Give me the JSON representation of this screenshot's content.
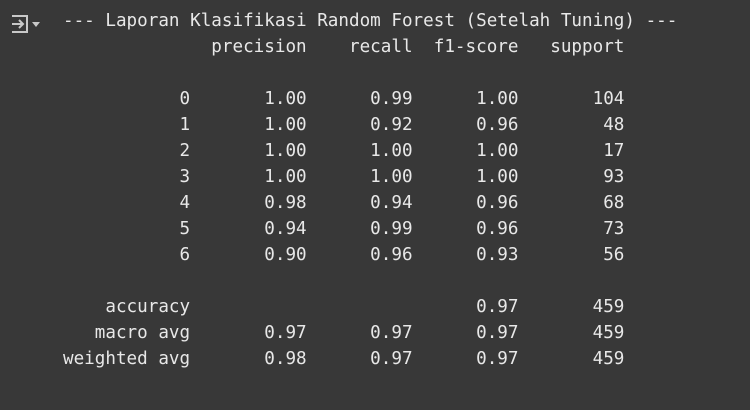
{
  "output": {
    "toggle_icon": "output-collapse-icon",
    "title": "--- Laporan Klasifikasi Random Forest (Setelah Tuning) ---",
    "header": "              precision    recall  f1-score   support",
    "rows": [
      "",
      "           0       1.00      0.99      1.00       104",
      "           1       1.00      0.92      0.96        48",
      "           2       1.00      1.00      1.00        17",
      "           3       1.00      1.00      1.00        93",
      "           4       0.98      0.94      0.96        68",
      "           5       0.94      0.99      0.96        73",
      "           6       0.90      0.96      0.93        56",
      "",
      "    accuracy                           0.97       459",
      "   macro avg       0.97      0.97      0.97       459",
      "weighted avg       0.98      0.97      0.97       459"
    ]
  },
  "colors": {
    "background": "#383838",
    "text": "#e8e8e8",
    "icon": "#c8c8c8"
  }
}
